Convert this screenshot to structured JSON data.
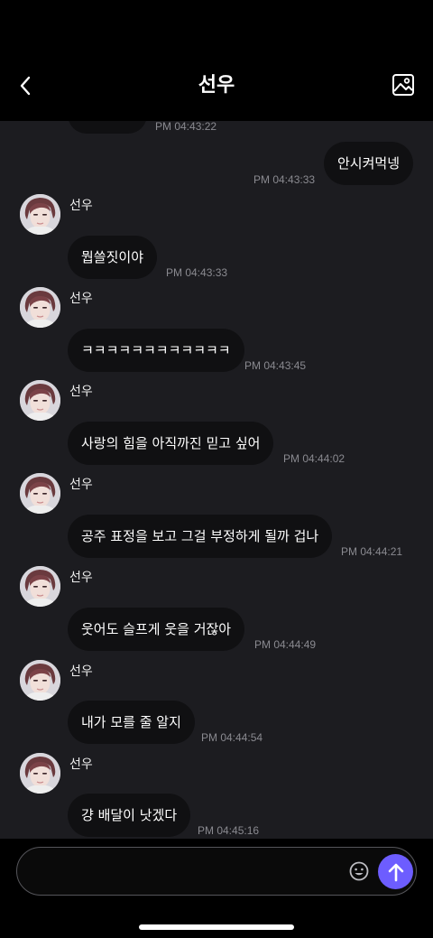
{
  "header": {
    "title": "선우"
  },
  "contact": {
    "name": "선우"
  },
  "messages": [
    {
      "text": "",
      "time": "PM 04:43:22"
    },
    {
      "text": "안시켜먹넹",
      "time": "PM 04:43:33"
    },
    {
      "text": "뭡쓸짓이야",
      "time": "PM 04:43:33"
    },
    {
      "text": "ㅋㅋㅋㅋㅋㅋㅋㅋㅋㅋㅋㅋ",
      "time": "PM 04:43:45"
    },
    {
      "text": "사랑의 힘을 아직까진 믿고 싶어",
      "time": "PM 04:44:02"
    },
    {
      "text": "공주 표정을 보고 그걸 부정하게 될까 겁나",
      "time": "PM 04:44:21"
    },
    {
      "text": "웃어도 슬프게 웃을 거잖아",
      "time": "PM 04:44:49"
    },
    {
      "text": "내가 모를 줄 알지",
      "time": "PM 04:44:54"
    },
    {
      "text": "걍 배달이 낫겠다",
      "time": "PM 04:45:16"
    }
  ],
  "input": {
    "placeholder": ""
  },
  "icons": {
    "back": "chevron-left-icon",
    "gallery": "image-icon",
    "emoji": "smiley-icon",
    "send": "arrow-up-icon"
  },
  "colors": {
    "background": "#1c1c20",
    "bubble": "#101012",
    "send_button": "#6d5dff",
    "timestamp": "#8a8a90"
  }
}
